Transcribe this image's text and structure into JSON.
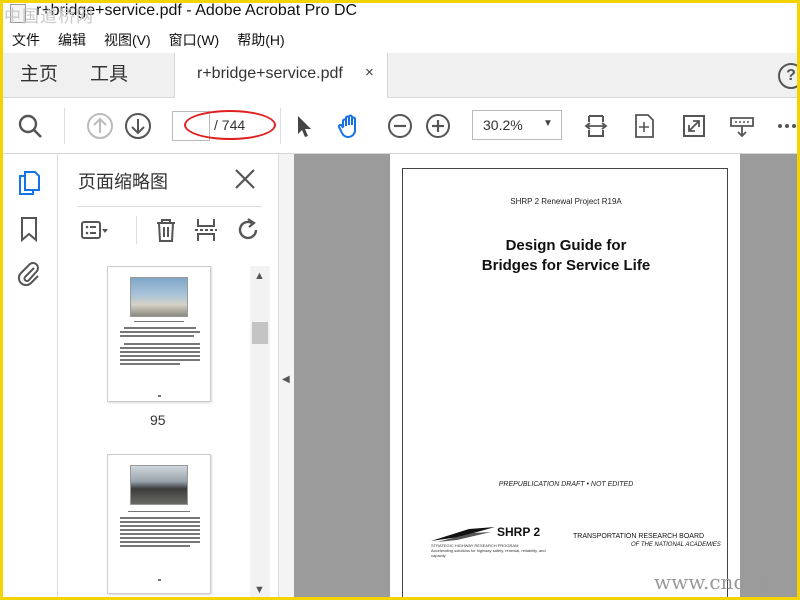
{
  "window": {
    "title": "r+bridge+service.pdf - Adobe Acrobat Pro DC",
    "watermark_top": "中国道桥网"
  },
  "menu": [
    "文件",
    "编辑",
    "视图(V)",
    "窗口(W)",
    "帮助(H)"
  ],
  "tabs": {
    "home": "主页",
    "tools": "工具",
    "document": "r+bridge+service.pdf",
    "close_glyph": "×",
    "help_glyph": "?"
  },
  "toolbar": {
    "page_current": "",
    "page_total": "/ 744",
    "zoom": "30.2%"
  },
  "panel": {
    "title": "页面缩略图",
    "thumbnails": [
      {
        "label": "95"
      },
      {
        "label": ""
      }
    ]
  },
  "document_page": {
    "project": "SHRP 2 Renewal Project R19A",
    "title_line1": "Design Guide for",
    "title_line2": "Bridges for Service Life",
    "draft_note": "PREPUBLICATION DRAFT  •  NOT EDITED",
    "shrp_logo_text": "SHRP 2",
    "shrp_sub1": "STRATEGIC HIGHWAY RESEARCH PROGRAM",
    "shrp_sub2": "Accelerating solutions for highway safety, renewal, reliability, and capacity",
    "trb_line1": "TRANSPORTATION RESEARCH BOARD",
    "trb_line2": "OF THE NATIONAL ACADEMIES"
  },
  "watermark_bottom": "www.cndao",
  "colors": {
    "accent_blue": "#1473e6",
    "annotation_red": "#e02020",
    "frame_yellow": "#f3d400"
  }
}
